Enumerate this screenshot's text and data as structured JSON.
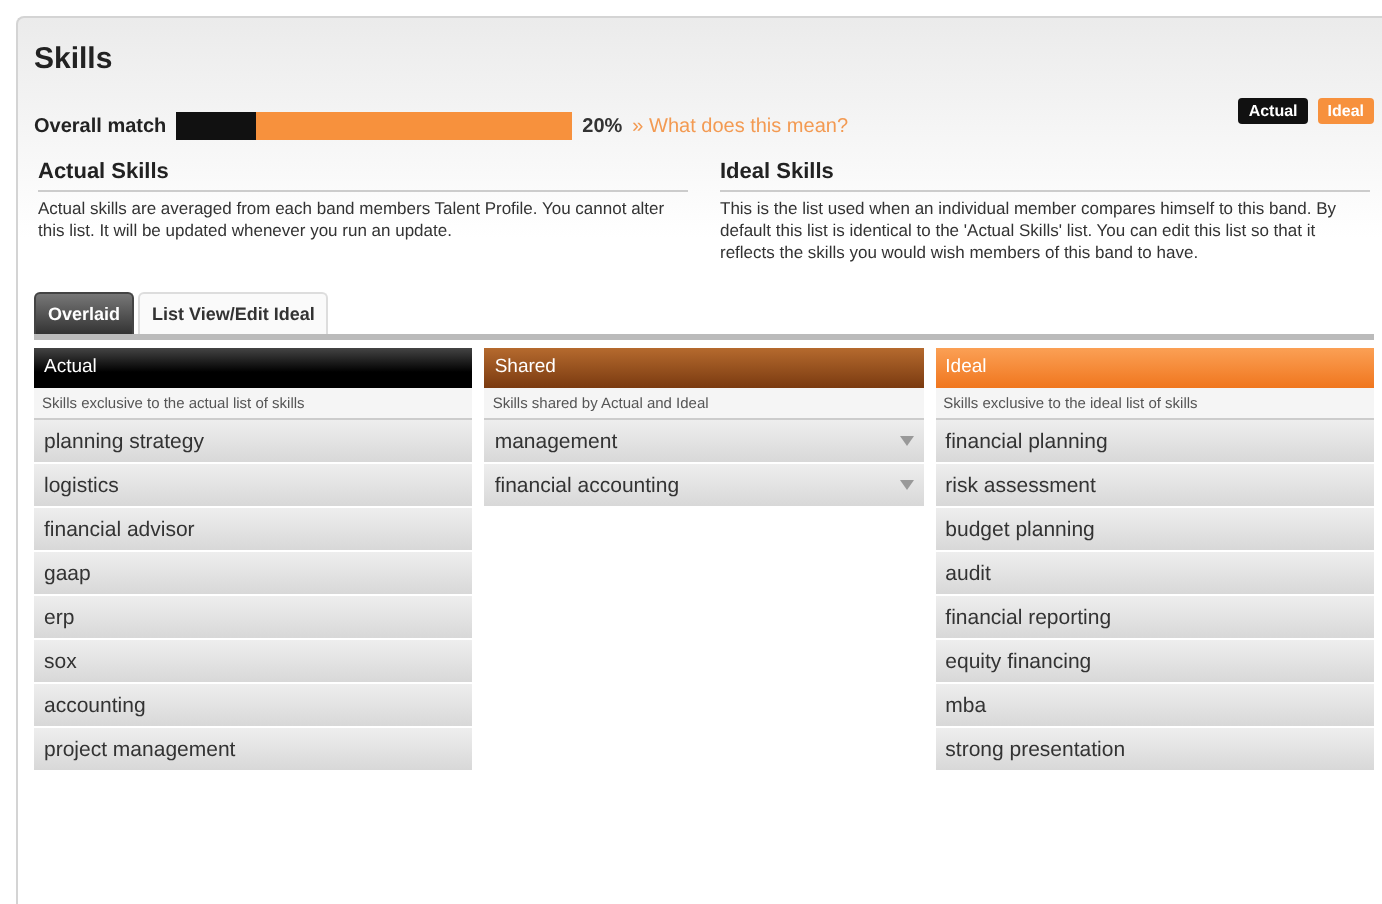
{
  "title": "Skills",
  "legend": [
    {
      "label": "Actual",
      "color": "#111111"
    },
    {
      "label": "Ideal",
      "color": "#f7913d"
    }
  ],
  "overall_match": {
    "label": "Overall match",
    "level": 0.2,
    "reading": "20%",
    "link": "» What does this mean?"
  },
  "info": [
    {
      "heading": "Actual Skills",
      "text": "Actual skills are averaged from each band members Talent Profile. You cannot alter this list. It will be updated whenever you run an update."
    },
    {
      "heading": "Ideal Skills",
      "text": "This is the list used when an individual member compares himself to this band. By default this list is identical to the 'Actual Skills' list. You can edit this list so that it reflects the skills you would wish members of this band to have."
    }
  ],
  "tabs": [
    {
      "label": "Overlaid",
      "selected": true
    },
    {
      "label": "List View/Edit Ideal",
      "selected": false
    }
  ],
  "columns": [
    {
      "kind": "actual",
      "title": "Actual",
      "subtitle": "Skills exclusive to the actual list of skills",
      "items": [
        "planning strategy",
        "logistics",
        "financial advisor",
        "gaap",
        "erp",
        "sox",
        "accounting",
        "project management"
      ]
    },
    {
      "kind": "shared",
      "title": "Shared",
      "subtitle": "Skills shared by Actual and Ideal",
      "items": [
        "management",
        "financial accounting"
      ]
    },
    {
      "kind": "ideal",
      "title": "Ideal",
      "subtitle": "Skills exclusive to the ideal list of skills",
      "items": [
        "financial planning",
        "risk assessment",
        "budget planning",
        "audit",
        "financial reporting",
        "equity financing",
        "mba",
        "strong presentation"
      ]
    }
  ]
}
